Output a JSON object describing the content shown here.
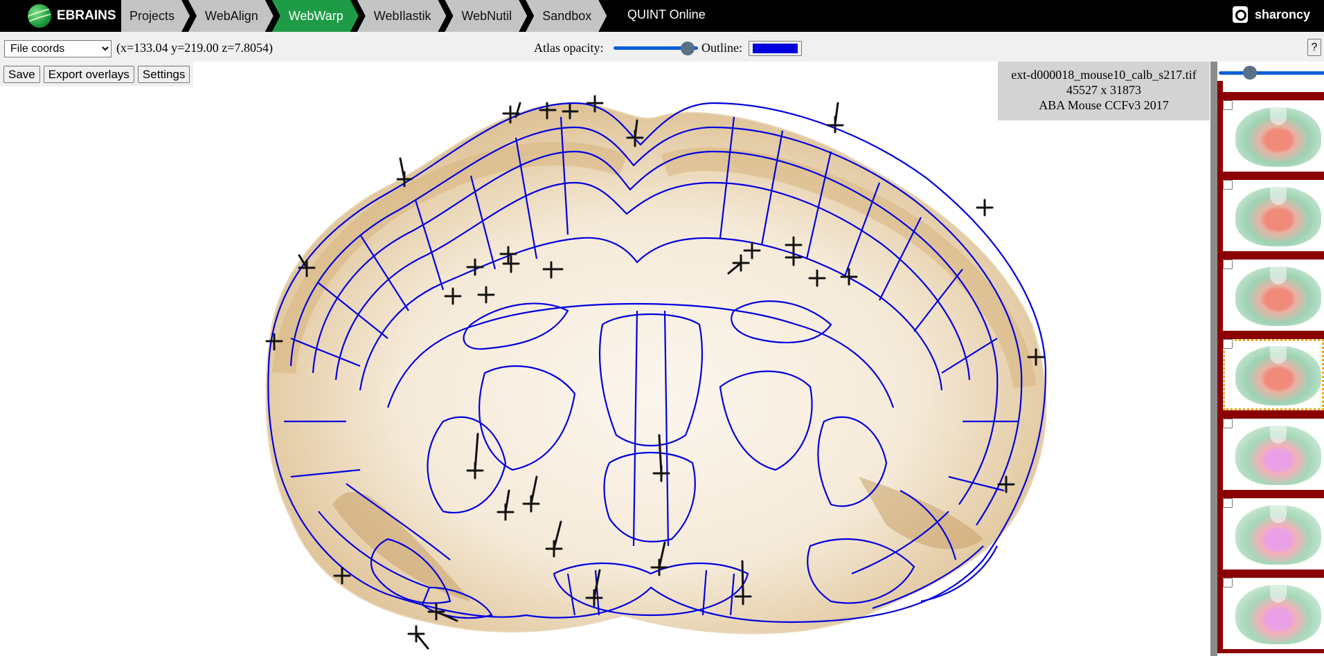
{
  "navbar": {
    "brand": "EBRAINS",
    "tabs": [
      {
        "label": "Projects",
        "active": false
      },
      {
        "label": "WebAlign",
        "active": false
      },
      {
        "label": "WebWarp",
        "active": true
      },
      {
        "label": "WebIlastik",
        "active": false
      },
      {
        "label": "WebNutil",
        "active": false
      },
      {
        "label": "Sandbox",
        "active": false
      }
    ],
    "app_title": "QUINT Online",
    "username": "sharoncy"
  },
  "toolbar": {
    "coord_mode": "File coords",
    "coord_readout": "(x=133.04 y=219.00 z=7.8054)",
    "opacity_label": "Atlas opacity:",
    "opacity_value": 0.88,
    "outline_label": "Outline:",
    "outline_color": "#0000e0",
    "help_label": "?"
  },
  "actions": {
    "save": "Save",
    "export": "Export overlays",
    "settings": "Settings"
  },
  "image_info": {
    "filename": "ext-d000018_mouse10_calb_s217.tif",
    "dimensions": "45527 x 31873",
    "atlas": "ABA Mouse CCFv3 2017"
  },
  "filmstrip": {
    "slider_value": 0.28,
    "thumbnails": [
      {
        "checked": false,
        "selected": false,
        "tint": "red"
      },
      {
        "checked": false,
        "selected": false,
        "tint": "red"
      },
      {
        "checked": false,
        "selected": false,
        "tint": "red"
      },
      {
        "checked": false,
        "selected": true,
        "tint": "red"
      },
      {
        "checked": false,
        "selected": false,
        "tint": "pink"
      },
      {
        "checked": false,
        "selected": false,
        "tint": "pink"
      },
      {
        "checked": false,
        "selected": false,
        "tint": "pink"
      }
    ]
  },
  "colors": {
    "active_tab": "#1e9b47",
    "atlas_outline": "#0000e0",
    "tissue_stain": "#d8b98a",
    "filmstrip_frame": "#8b0000",
    "selected_frame": "#f2a400"
  },
  "markers_count_label": ""
}
